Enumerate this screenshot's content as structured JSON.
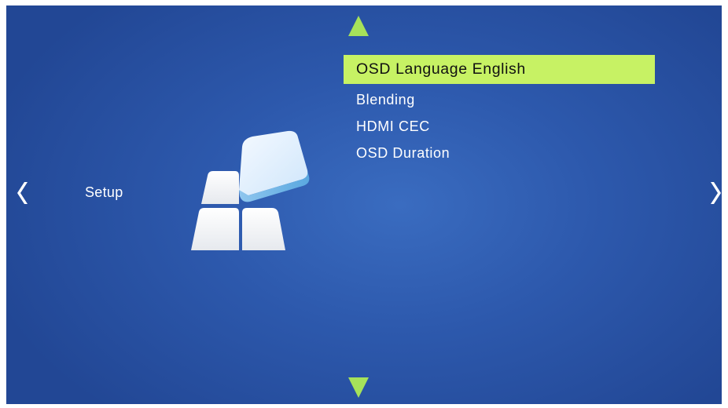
{
  "category": {
    "label": "Setup",
    "icon": "setup-tiles-icon"
  },
  "navigation": {
    "up_icon": "triangle-up-icon",
    "down_icon": "triangle-down-icon",
    "left_icon": "chevron-left-icon",
    "right_icon": "chevron-right-icon"
  },
  "menu": {
    "items": [
      {
        "label": "OSD Language English",
        "selected": true
      },
      {
        "label": "Blending",
        "selected": false
      },
      {
        "label": "HDMI CEC",
        "selected": false
      },
      {
        "label": "OSD Duration",
        "selected": false
      }
    ]
  },
  "colors": {
    "background": "#2d59ad",
    "highlight": "#c7f264",
    "arrow": "#a6e25a",
    "text": "#ffffff"
  }
}
